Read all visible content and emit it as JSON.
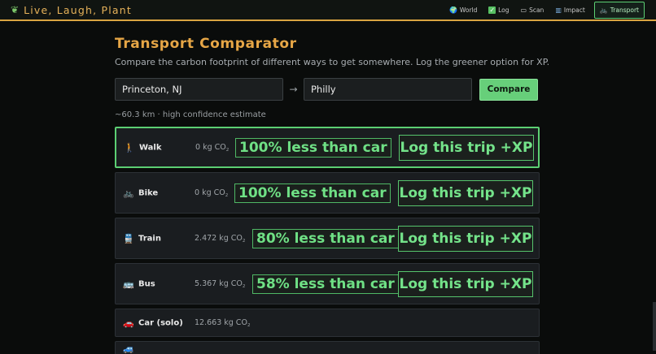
{
  "app": {
    "brand": "Live, Laugh, Plant",
    "brand_icon": "seedling-icon"
  },
  "nav": [
    {
      "label": "World",
      "icon": "globe-icon",
      "glyph": "🌍",
      "active": false
    },
    {
      "label": "Log",
      "icon": "check-icon",
      "glyph": "✓",
      "active": false
    },
    {
      "label": "Scan",
      "icon": "scanner-icon",
      "glyph": "▭",
      "active": false
    },
    {
      "label": "Impact",
      "icon": "chart-icon",
      "glyph": "▥",
      "active": false
    },
    {
      "label": "Transport",
      "icon": "bike-icon",
      "glyph": "🚲",
      "active": true
    }
  ],
  "page": {
    "title": "Transport Comparator",
    "subtitle": "Compare the carbon footprint of different ways to get somewhere. Log the greener option for XP."
  },
  "form": {
    "origin_value": "Princeton, NJ",
    "arrow": "→",
    "destination_value": "Philly",
    "compare_label": "Compare"
  },
  "estimate": "~60.3 km · high confidence estimate",
  "modes": [
    {
      "name": "Walk",
      "glyph": "🚶",
      "icon": "walk-icon",
      "co2": "0 kg CO",
      "pct": "100% less than car",
      "log": "Log this trip +XP"
    },
    {
      "name": "Bike",
      "glyph": "🚲",
      "icon": "bike-icon",
      "co2": "0 kg CO",
      "pct": "100% less than car",
      "log": "Log this trip +XP"
    },
    {
      "name": "Train",
      "glyph": "🚆",
      "icon": "train-icon",
      "co2": "2.472 kg CO",
      "pct": "80% less than car",
      "log": "Log this trip +XP"
    },
    {
      "name": "Bus",
      "glyph": "🚌",
      "icon": "bus-icon",
      "co2": "5.367 kg CO",
      "pct": "58% less than car",
      "log": "Log this trip +XP"
    },
    {
      "name": "Car (solo)",
      "glyph": "🚗",
      "icon": "car-icon",
      "co2": "12.663 kg CO"
    },
    {
      "glyph": "🚙",
      "icon": "vehicle-icon"
    }
  ],
  "co2_subscript": "2",
  "colors": {
    "accent_gold": "#e6a646",
    "accent_green": "#5ccf73",
    "background": "#0a0c0b"
  }
}
